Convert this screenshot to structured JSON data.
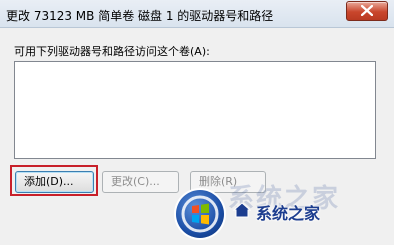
{
  "window": {
    "title": "更改 73123 MB 简单卷 磁盘 1 的驱动器号和路径",
    "close_icon": "close-icon"
  },
  "dialog": {
    "instruction": "可用下列驱动器号和路径访问这个卷(A):",
    "access_paths": []
  },
  "buttons": {
    "add": "添加(D)...",
    "change": "更改(C)...",
    "delete": "删除(R)"
  },
  "watermark": {
    "text": "系统之家",
    "logo_icon": "windows-logo-icon"
  },
  "colors": {
    "highlight": "#c8202a",
    "close_button": "#c9462c"
  }
}
